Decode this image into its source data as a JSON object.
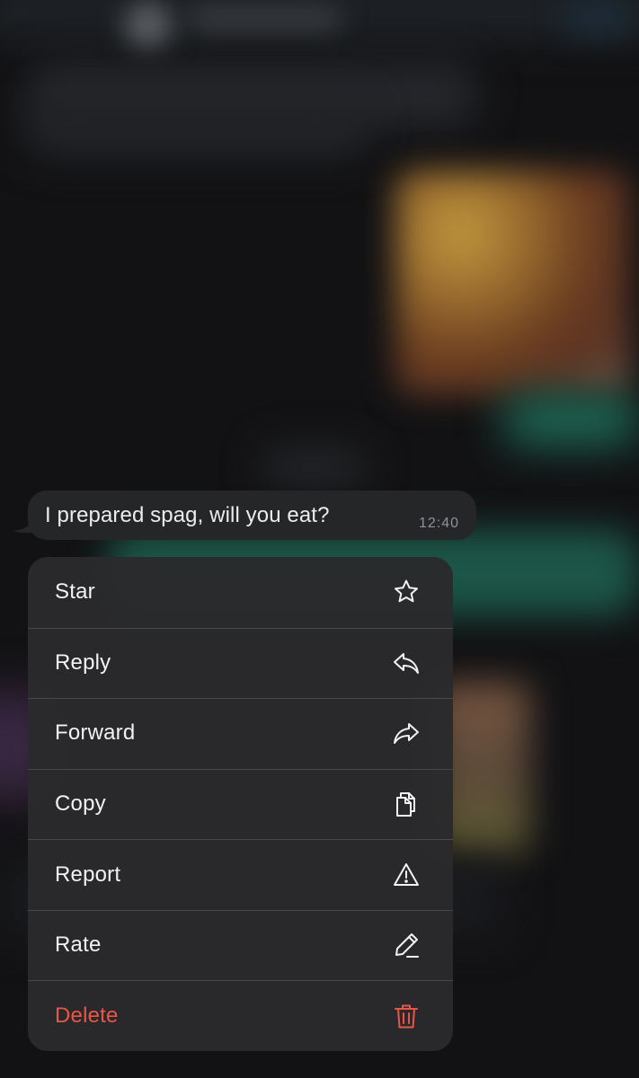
{
  "message": {
    "text": "I prepared spag, will you eat?",
    "time": "12:40"
  },
  "menu": {
    "items": [
      {
        "label": "Star",
        "icon": "star-icon"
      },
      {
        "label": "Reply",
        "icon": "reply-icon"
      },
      {
        "label": "Forward",
        "icon": "forward-icon"
      },
      {
        "label": "Copy",
        "icon": "copy-icon"
      },
      {
        "label": "Report",
        "icon": "warning-icon"
      },
      {
        "label": "Rate",
        "icon": "pencil-icon"
      },
      {
        "label": "Delete",
        "icon": "trash-icon",
        "color": "#eb5545"
      }
    ]
  },
  "colors": {
    "background": "#101012",
    "bubble": "#252628",
    "menu": "#2a2a2c",
    "danger": "#eb5545"
  }
}
